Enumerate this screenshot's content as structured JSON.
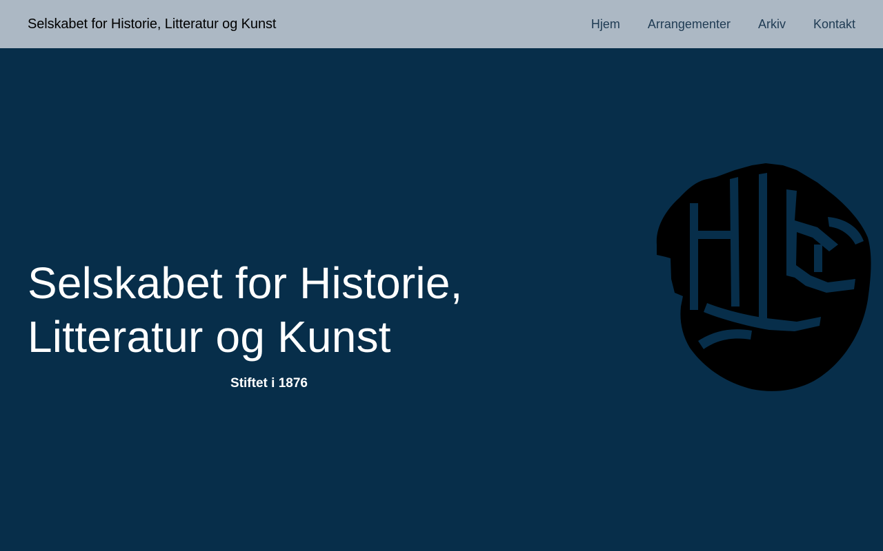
{
  "header": {
    "site_title": "Selskabet for Historie, Litteratur og Kunst",
    "nav": [
      {
        "label": "Hjem"
      },
      {
        "label": "Arrangementer"
      },
      {
        "label": "Arkiv"
      },
      {
        "label": "Kontakt"
      }
    ]
  },
  "hero": {
    "title_line1": "Selskabet for Historie,",
    "title_line2": "Litteratur og Kunst",
    "subtitle": "Stiftet i 1876",
    "logo_icon": "hlk-monogram-logo-icon"
  },
  "colors": {
    "header_bg": "#acb8c4",
    "hero_bg": "#072e4a",
    "nav_text": "#1f3b53",
    "title_text": "#000000",
    "hero_text": "#ffffff",
    "logo": "#000000"
  }
}
